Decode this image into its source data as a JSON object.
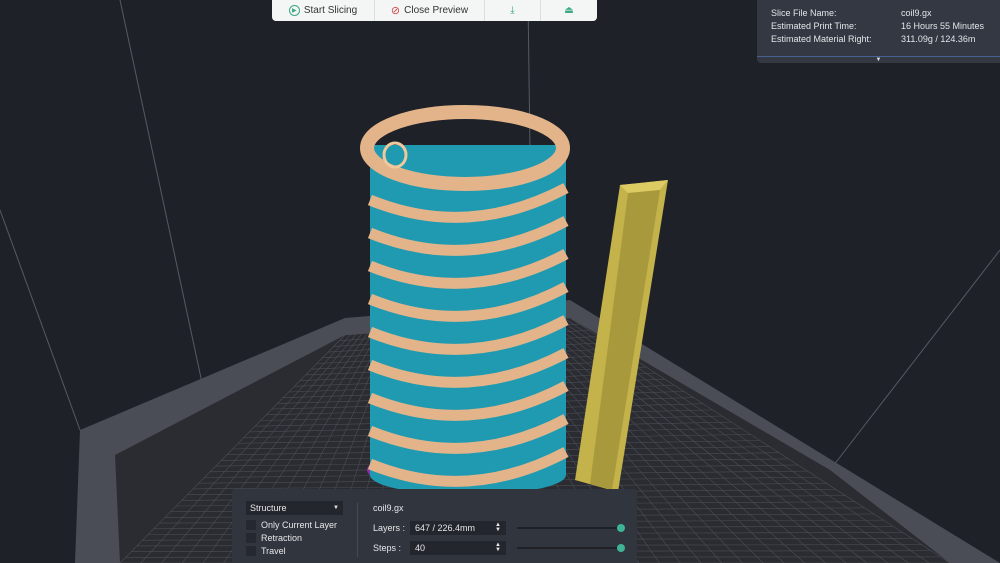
{
  "toolbar": {
    "start_slicing": "Start Slicing",
    "close_preview": "Close Preview",
    "export_icon": "download-icon",
    "print_icon": "send-to-printer-icon"
  },
  "info": {
    "rows": [
      {
        "label": "Slice File Name:",
        "value": "coil9.gx"
      },
      {
        "label": "Estimated Print Time:",
        "value": "16 Hours 55 Minutes"
      },
      {
        "label": "Estimated Material Right:",
        "value": "311.09g / 124.36m"
      }
    ]
  },
  "panel": {
    "view_mode": "Structure",
    "options": [
      "Only Current Layer",
      "Retraction",
      "Travel"
    ],
    "file_name": "coil9.gx",
    "layers_label": "Layers :",
    "layers_value": "647 / 226.4mm",
    "layers_fraction": 1.0,
    "steps_label": "Steps :",
    "steps_value": "40",
    "steps_fraction": 1.0
  },
  "colors": {
    "accent": "#3fb395",
    "coil_wall": "#1f9ab0",
    "coil_spiral": "#e3b48a",
    "pillar": "#c4b24a",
    "skirt": "#8a2fa8"
  }
}
